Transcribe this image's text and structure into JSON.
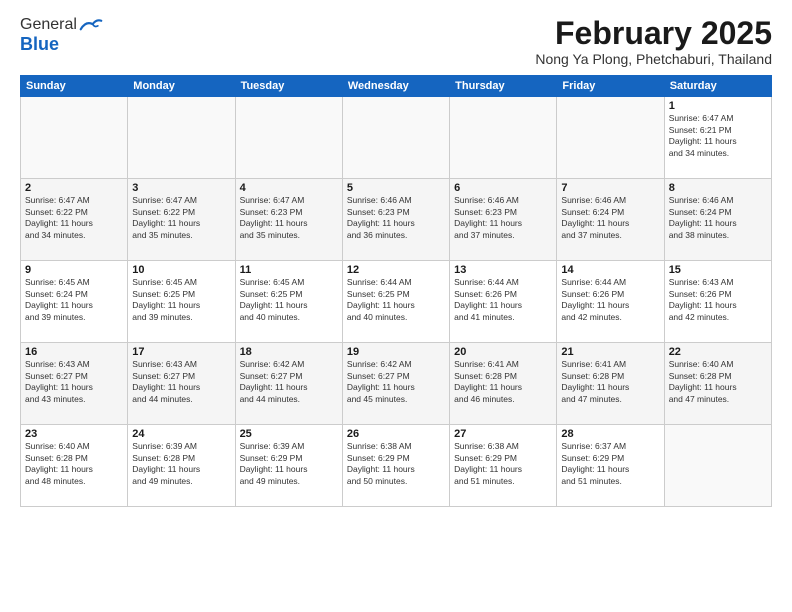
{
  "header": {
    "logo_general": "General",
    "logo_blue": "Blue",
    "month_title": "February 2025",
    "location": "Nong Ya Plong, Phetchaburi, Thailand"
  },
  "weekdays": [
    "Sunday",
    "Monday",
    "Tuesday",
    "Wednesday",
    "Thursday",
    "Friday",
    "Saturday"
  ],
  "weeks": [
    [
      {
        "day": "",
        "info": ""
      },
      {
        "day": "",
        "info": ""
      },
      {
        "day": "",
        "info": ""
      },
      {
        "day": "",
        "info": ""
      },
      {
        "day": "",
        "info": ""
      },
      {
        "day": "",
        "info": ""
      },
      {
        "day": "1",
        "info": "Sunrise: 6:47 AM\nSunset: 6:21 PM\nDaylight: 11 hours\nand 34 minutes."
      }
    ],
    [
      {
        "day": "2",
        "info": "Sunrise: 6:47 AM\nSunset: 6:22 PM\nDaylight: 11 hours\nand 34 minutes."
      },
      {
        "day": "3",
        "info": "Sunrise: 6:47 AM\nSunset: 6:22 PM\nDaylight: 11 hours\nand 35 minutes."
      },
      {
        "day": "4",
        "info": "Sunrise: 6:47 AM\nSunset: 6:23 PM\nDaylight: 11 hours\nand 35 minutes."
      },
      {
        "day": "5",
        "info": "Sunrise: 6:46 AM\nSunset: 6:23 PM\nDaylight: 11 hours\nand 36 minutes."
      },
      {
        "day": "6",
        "info": "Sunrise: 6:46 AM\nSunset: 6:23 PM\nDaylight: 11 hours\nand 37 minutes."
      },
      {
        "day": "7",
        "info": "Sunrise: 6:46 AM\nSunset: 6:24 PM\nDaylight: 11 hours\nand 37 minutes."
      },
      {
        "day": "8",
        "info": "Sunrise: 6:46 AM\nSunset: 6:24 PM\nDaylight: 11 hours\nand 38 minutes."
      }
    ],
    [
      {
        "day": "9",
        "info": "Sunrise: 6:45 AM\nSunset: 6:24 PM\nDaylight: 11 hours\nand 39 minutes."
      },
      {
        "day": "10",
        "info": "Sunrise: 6:45 AM\nSunset: 6:25 PM\nDaylight: 11 hours\nand 39 minutes."
      },
      {
        "day": "11",
        "info": "Sunrise: 6:45 AM\nSunset: 6:25 PM\nDaylight: 11 hours\nand 40 minutes."
      },
      {
        "day": "12",
        "info": "Sunrise: 6:44 AM\nSunset: 6:25 PM\nDaylight: 11 hours\nand 40 minutes."
      },
      {
        "day": "13",
        "info": "Sunrise: 6:44 AM\nSunset: 6:26 PM\nDaylight: 11 hours\nand 41 minutes."
      },
      {
        "day": "14",
        "info": "Sunrise: 6:44 AM\nSunset: 6:26 PM\nDaylight: 11 hours\nand 42 minutes."
      },
      {
        "day": "15",
        "info": "Sunrise: 6:43 AM\nSunset: 6:26 PM\nDaylight: 11 hours\nand 42 minutes."
      }
    ],
    [
      {
        "day": "16",
        "info": "Sunrise: 6:43 AM\nSunset: 6:27 PM\nDaylight: 11 hours\nand 43 minutes."
      },
      {
        "day": "17",
        "info": "Sunrise: 6:43 AM\nSunset: 6:27 PM\nDaylight: 11 hours\nand 44 minutes."
      },
      {
        "day": "18",
        "info": "Sunrise: 6:42 AM\nSunset: 6:27 PM\nDaylight: 11 hours\nand 44 minutes."
      },
      {
        "day": "19",
        "info": "Sunrise: 6:42 AM\nSunset: 6:27 PM\nDaylight: 11 hours\nand 45 minutes."
      },
      {
        "day": "20",
        "info": "Sunrise: 6:41 AM\nSunset: 6:28 PM\nDaylight: 11 hours\nand 46 minutes."
      },
      {
        "day": "21",
        "info": "Sunrise: 6:41 AM\nSunset: 6:28 PM\nDaylight: 11 hours\nand 47 minutes."
      },
      {
        "day": "22",
        "info": "Sunrise: 6:40 AM\nSunset: 6:28 PM\nDaylight: 11 hours\nand 47 minutes."
      }
    ],
    [
      {
        "day": "23",
        "info": "Sunrise: 6:40 AM\nSunset: 6:28 PM\nDaylight: 11 hours\nand 48 minutes."
      },
      {
        "day": "24",
        "info": "Sunrise: 6:39 AM\nSunset: 6:28 PM\nDaylight: 11 hours\nand 49 minutes."
      },
      {
        "day": "25",
        "info": "Sunrise: 6:39 AM\nSunset: 6:29 PM\nDaylight: 11 hours\nand 49 minutes."
      },
      {
        "day": "26",
        "info": "Sunrise: 6:38 AM\nSunset: 6:29 PM\nDaylight: 11 hours\nand 50 minutes."
      },
      {
        "day": "27",
        "info": "Sunrise: 6:38 AM\nSunset: 6:29 PM\nDaylight: 11 hours\nand 51 minutes."
      },
      {
        "day": "28",
        "info": "Sunrise: 6:37 AM\nSunset: 6:29 PM\nDaylight: 11 hours\nand 51 minutes."
      },
      {
        "day": "",
        "info": ""
      }
    ]
  ]
}
